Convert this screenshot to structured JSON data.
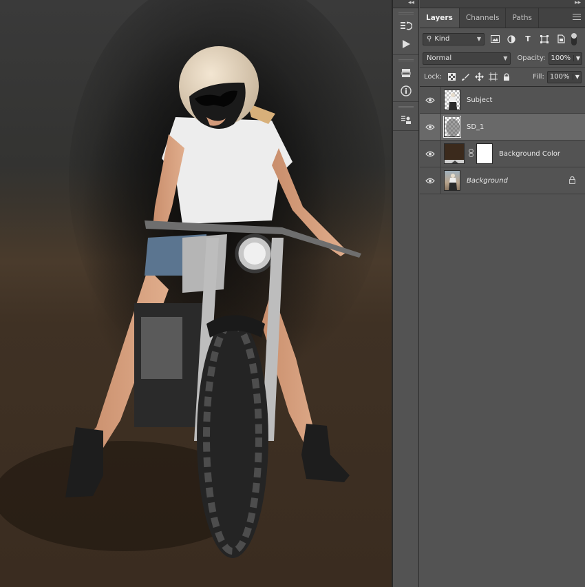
{
  "panel": {
    "tabs": [
      {
        "label": "Layers",
        "active": true
      },
      {
        "label": "Channels",
        "active": false
      },
      {
        "label": "Paths",
        "active": false
      }
    ],
    "filter": {
      "kind_label": "Kind"
    },
    "blend_mode": "Normal",
    "opacity_label": "Opacity:",
    "opacity_value": "100%",
    "lock_label": "Lock:",
    "fill_label": "Fill:",
    "fill_value": "100%",
    "layers": [
      {
        "name": "Subject",
        "visible": true,
        "selected": false,
        "thumbnail": "subject-cutout"
      },
      {
        "name": "SD_1",
        "visible": true,
        "selected": true,
        "thumbnail": "smoke-transparent"
      },
      {
        "name": "Background Color",
        "visible": true,
        "selected": false,
        "thumbnail": "solid-color-fill",
        "fill_color": "#3b2a1c",
        "has_mask": true
      },
      {
        "name": "Background",
        "visible": true,
        "selected": false,
        "thumbnail": "photo",
        "locked": true,
        "italic": true
      }
    ]
  },
  "tool_strip": {
    "icons": [
      "history-icon",
      "play-actions-icon",
      "libraries-icon",
      "info-icon",
      "properties-icon"
    ]
  },
  "colors": {
    "panel_bg": "#535353",
    "panel_dark": "#424242",
    "selected_layer": "#696969",
    "background_color_fill": "#3b2a1c"
  }
}
